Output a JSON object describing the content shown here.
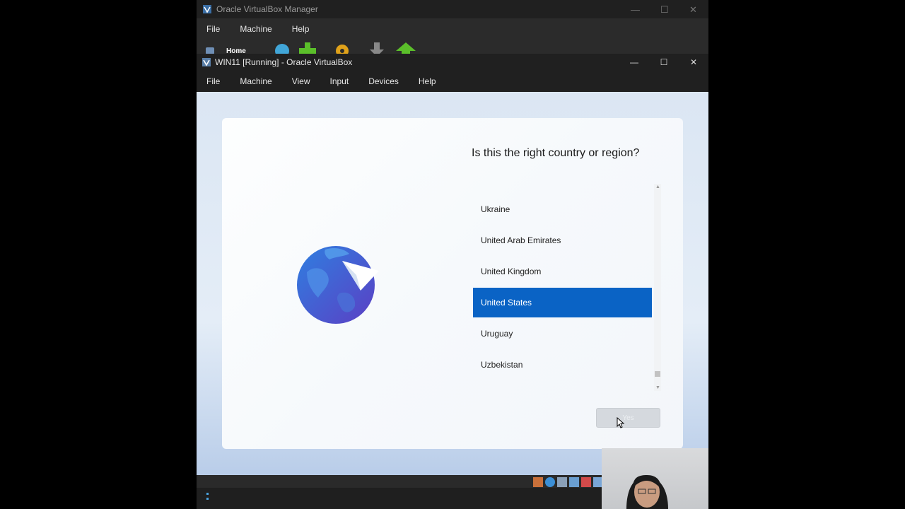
{
  "manager": {
    "title": "Oracle VirtualBox Manager",
    "menu": [
      "File",
      "Machine",
      "Help"
    ],
    "toolbar_home": "Home"
  },
  "vm": {
    "title": "WIN11 [Running] - Oracle VirtualBox",
    "menu": [
      "File",
      "Machine",
      "View",
      "Input",
      "Devices",
      "Help"
    ]
  },
  "setup": {
    "question": "Is this the right country or region?",
    "countries": [
      "Ukraine",
      "United Arab Emirates",
      "United Kingdom",
      "United States",
      "Uruguay",
      "Uzbekistan"
    ],
    "selected": "United States",
    "yes_label": "Yes"
  },
  "colors": {
    "accent": "#0a63c5",
    "titlebar": "#202020"
  },
  "icons": {
    "globe": "globe-icon",
    "paper_plane": "paper-plane-icon",
    "cursor": "mouse-cursor-icon"
  }
}
